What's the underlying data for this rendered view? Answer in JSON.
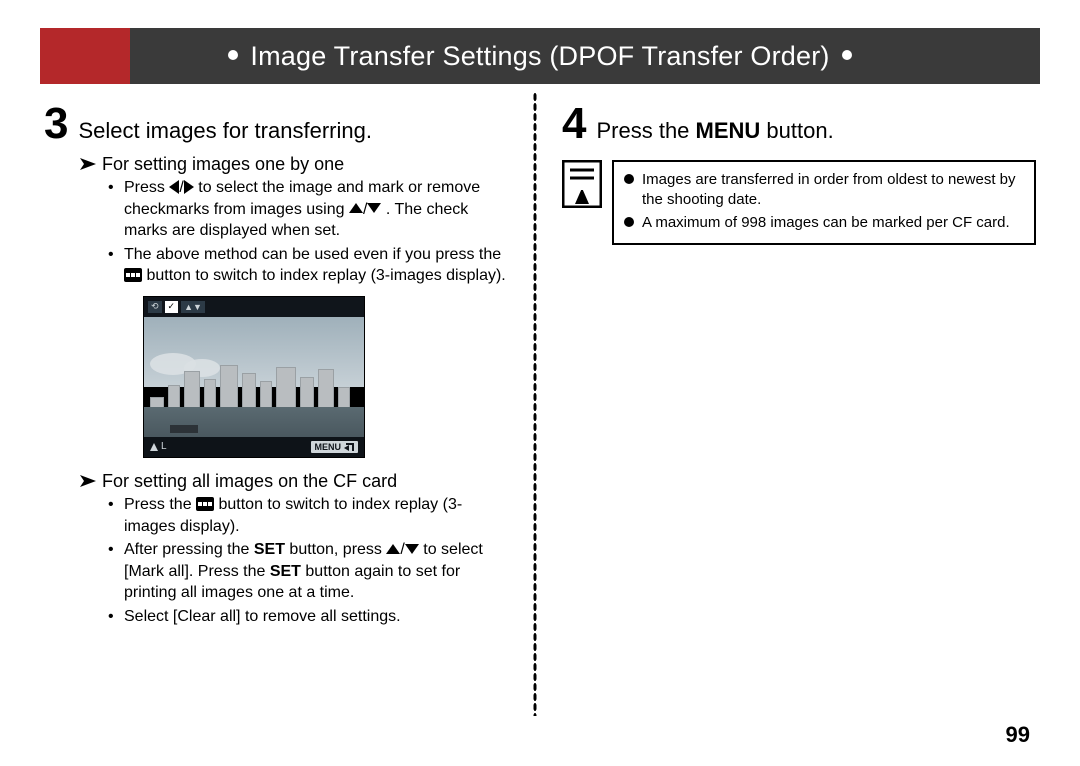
{
  "header": {
    "title": "Image Transfer Settings (DPOF Transfer Order)"
  },
  "left": {
    "step_num": "3",
    "step_title": "Select images for transferring.",
    "sub_a": "For setting images one by one",
    "sub_a_items": {
      "i1a": "Press ",
      "i1b": " to select the image and mark or remove checkmarks from images using ",
      "i1c": ". The check marks are displayed when set.",
      "i2a": "The above method can be used even if you press the ",
      "i2b": " button to switch to index replay (3-images display)."
    },
    "sub_b": "For setting all images on the CF card",
    "sub_b_items": {
      "i1a": "Press the ",
      "i1b": " button to switch to index replay (3-images display).",
      "i2a": "After pressing the ",
      "i2b": "SET",
      "i2c": " button, press ",
      "i2d": " to select [Mark all]. Press the ",
      "i2e": "SET",
      "i2f": " button again to set for printing all images one at a time.",
      "i3": "Select [Clear all] to remove all settings."
    },
    "lcd": {
      "top_check": "✓",
      "menu_label": "MENU",
      "size_label": "L"
    }
  },
  "right": {
    "step_num": "4",
    "step_title_a": "Press the ",
    "step_title_bold": "MENU",
    "step_title_b": " button.",
    "notes": {
      "n1": "Images are transferred in order from oldest to newest by the shooting date.",
      "n2": "A maximum of 998 images can be marked per CF card."
    }
  },
  "page_number": "99"
}
